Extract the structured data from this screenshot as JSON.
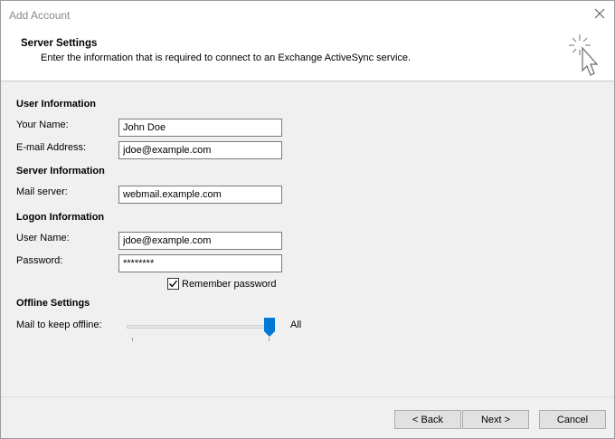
{
  "window": {
    "title": "Add Account"
  },
  "header": {
    "title": "Server Settings",
    "subtitle": "Enter the information that is required to connect to an Exchange ActiveSync service."
  },
  "user_info": {
    "heading": "User Information",
    "name_label": "Your Name:",
    "name_value": "John Doe",
    "email_label": "E-mail Address:",
    "email_value": "jdoe@example.com"
  },
  "server_info": {
    "heading": "Server Information",
    "mail_server_label": "Mail server:",
    "mail_server_value": "webmail.example.com"
  },
  "logon_info": {
    "heading": "Logon Information",
    "username_label": "User Name:",
    "username_value": "jdoe@example.com",
    "password_label": "Password:",
    "password_value": "********",
    "remember_label": "Remember password",
    "remember_checked": true
  },
  "offline": {
    "heading": "Offline Settings",
    "mail_keep_label": "Mail to keep offline:",
    "slider_value_label": "All",
    "slider_fraction": 1.0
  },
  "buttons": {
    "back": "< Back",
    "next": "Next >",
    "cancel": "Cancel"
  },
  "colors": {
    "accent": "#0078d7",
    "window_bg": "#f0f0f0"
  }
}
